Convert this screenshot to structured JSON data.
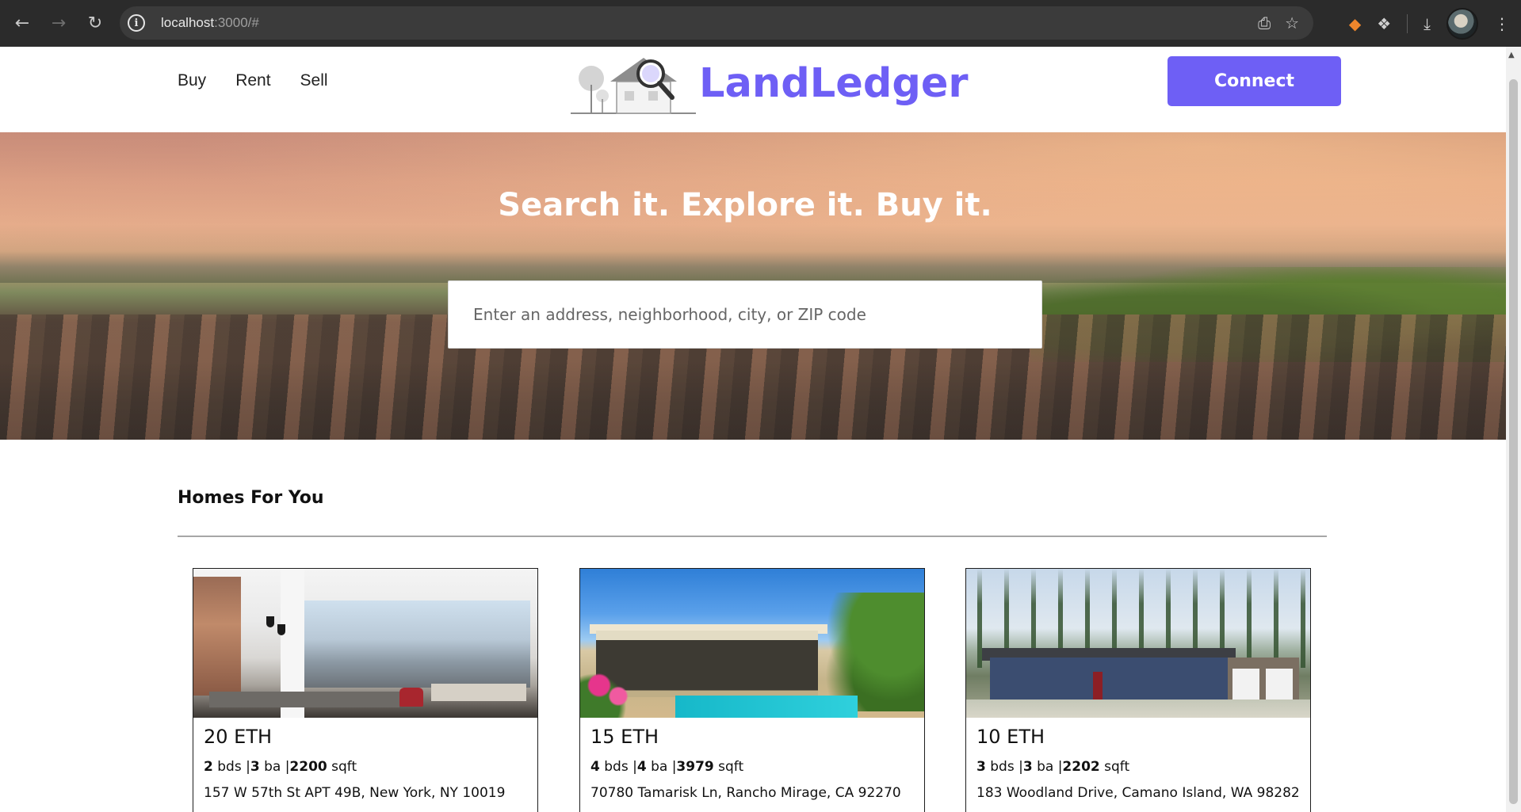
{
  "browser": {
    "url_host": "localhost",
    "url_path": ":3000/#",
    "nav": {
      "back": "←",
      "forward": "→",
      "reload": "↻"
    }
  },
  "header": {
    "nav_links": [
      "Buy",
      "Rent",
      "Sell"
    ],
    "brand": "LandLedger",
    "connect_label": "Connect"
  },
  "hero": {
    "headline": "Search it. Explore it. Buy it.",
    "search_placeholder": "Enter an address, neighborhood, city, or ZIP code"
  },
  "section": {
    "title": "Homes For You"
  },
  "listings": [
    {
      "price": "20 ETH",
      "beds": "2",
      "beds_unit": "bds |",
      "baths": "3",
      "baths_unit": "ba |",
      "sqft": "2200",
      "sqft_unit": "sqft",
      "address": "157 W 57th St APT 49B, New York, NY 10019"
    },
    {
      "price": "15 ETH",
      "beds": "4",
      "beds_unit": "bds |",
      "baths": "4",
      "baths_unit": "ba |",
      "sqft": "3979",
      "sqft_unit": "sqft",
      "address": "70780 Tamarisk Ln, Rancho Mirage, CA 92270"
    },
    {
      "price": "10 ETH",
      "beds": "3",
      "beds_unit": "bds |",
      "baths": "3",
      "baths_unit": "ba |",
      "sqft": "2202",
      "sqft_unit": "sqft",
      "address": "183 Woodland Drive, Camano Island, WA 98282"
    }
  ],
  "colors": {
    "accent": "#6e5ff5",
    "chrome": "#2b2b2b"
  }
}
